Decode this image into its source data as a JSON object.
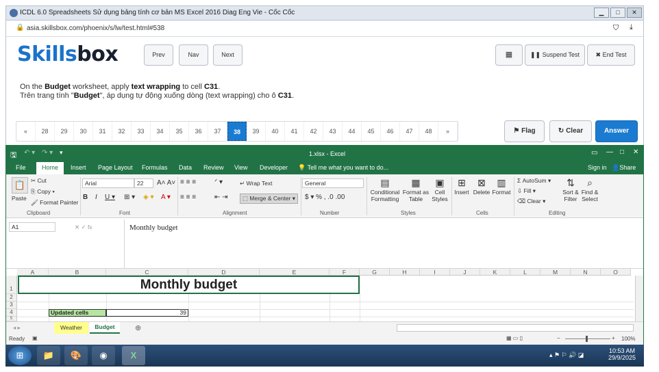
{
  "browser": {
    "title": "ICDL 6.0 Spreadsheets Sử dụng bảng tính cơ bản MS Excel 2016 Diag Eng Vie - Cốc Cốc",
    "url": "asia.skillsbox.com/phoenix/s/lw/test.html#538"
  },
  "test": {
    "logo_a": "Skills",
    "logo_b": "box",
    "prev": "Prev",
    "nav": "Nav",
    "next": "Next",
    "suspend": "Suspend Test",
    "end": "End Test",
    "q_en_1": "On the ",
    "q_en_b1": "Budget",
    "q_en_2": " worksheet, apply ",
    "q_en_b2": "text wrapping",
    "q_en_3": " to cell ",
    "q_en_b3": "C31",
    "q_en_4": ".",
    "q_vi_1": "Trên trang tính \"",
    "q_vi_b1": "Budget",
    "q_vi_2": "\", áp dụng tự động xuống dòng (text wrapping) cho ô ",
    "q_vi_b2": "C31",
    "q_vi_3": ".",
    "pages": [
      "«",
      "28",
      "29",
      "30",
      "31",
      "32",
      "33",
      "34",
      "35",
      "36",
      "37",
      "38",
      "39",
      "40",
      "41",
      "42",
      "43",
      "44",
      "45",
      "46",
      "47",
      "48",
      "»"
    ],
    "current_page": "38",
    "flag": "Flag",
    "clear": "Clear",
    "answer": "Answer"
  },
  "excel": {
    "title": "1.xlsx - Excel",
    "tabs": [
      "File",
      "Home",
      "Insert",
      "Page Layout",
      "Formulas",
      "Data",
      "Review",
      "View",
      "Developer"
    ],
    "tell_me": "Tell me what you want to do...",
    "sign_in": "Sign in",
    "share": "Share",
    "clipboard": {
      "paste": "Paste",
      "cut": "Cut",
      "copy": "Copy",
      "format_painter": "Format Painter",
      "label": "Clipboard"
    },
    "font": {
      "name": "Arial",
      "size": "22",
      "label": "Font"
    },
    "alignment": {
      "wrap": "Wrap Text",
      "merge": "Merge & Center",
      "label": "Alignment"
    },
    "number": {
      "format": "General",
      "label": "Number"
    },
    "styles": {
      "cond": "Conditional",
      "cond2": "Formatting",
      "fmt": "Format as",
      "fmt2": "Table",
      "cell": "Cell",
      "cell2": "Styles",
      "label": "Styles"
    },
    "cells": {
      "insert": "Insert",
      "delete": "Delete",
      "format": "Format",
      "label": "Cells"
    },
    "editing": {
      "autosum": "AutoSum",
      "fill": "Fill",
      "clear": "Clear",
      "sort": "Sort &",
      "sort2": "Filter",
      "find": "Find &",
      "find2": "Select",
      "label": "Editing"
    },
    "name_box": "A1",
    "formula": "Monthly budget",
    "columns": [
      "A",
      "B",
      "C",
      "D",
      "E",
      "F",
      "G",
      "H",
      "I",
      "J",
      "K",
      "L",
      "M",
      "N",
      "O"
    ],
    "rows": [
      "1",
      "2",
      "3",
      "4",
      "5"
    ],
    "cell_title": "Monthly budget",
    "cell_b4": "Updated cells",
    "cell_c4": "39",
    "sheets": [
      "Weather",
      "Budget"
    ],
    "status_ready": "Ready",
    "zoom": "100%"
  },
  "taskbar": {
    "time": "10:53 AM",
    "date": "29/9/2025"
  },
  "colors": {
    "brand_blue": "#1b73c9",
    "excel_green": "#217346",
    "answer_blue": "#1a7bd0"
  }
}
